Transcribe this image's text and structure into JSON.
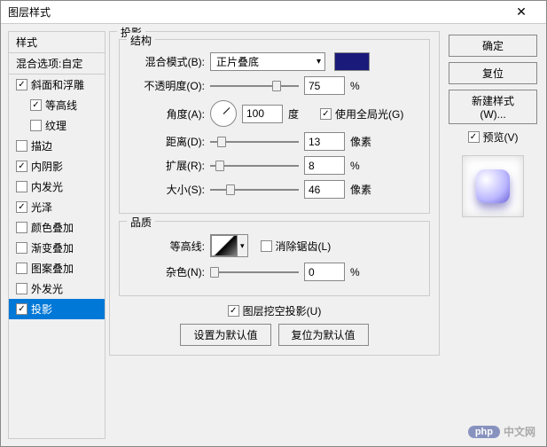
{
  "window": {
    "title": "图层样式",
    "close": "✕"
  },
  "left": {
    "header": "样式",
    "blend_options": "混合选项:自定",
    "items": [
      {
        "label": "斜面和浮雕",
        "checked": true,
        "indent": false
      },
      {
        "label": "等高线",
        "checked": true,
        "indent": true
      },
      {
        "label": "纹理",
        "checked": false,
        "indent": true
      },
      {
        "label": "描边",
        "checked": false,
        "indent": false
      },
      {
        "label": "内阴影",
        "checked": true,
        "indent": false
      },
      {
        "label": "内发光",
        "checked": false,
        "indent": false
      },
      {
        "label": "光泽",
        "checked": true,
        "indent": false
      },
      {
        "label": "颜色叠加",
        "checked": false,
        "indent": false
      },
      {
        "label": "渐变叠加",
        "checked": false,
        "indent": false
      },
      {
        "label": "图案叠加",
        "checked": false,
        "indent": false
      },
      {
        "label": "外发光",
        "checked": false,
        "indent": false
      },
      {
        "label": "投影",
        "checked": true,
        "indent": false,
        "selected": true
      }
    ]
  },
  "center": {
    "panel_title": "投影",
    "structure": {
      "legend": "结构",
      "blend_mode_label": "混合模式(B):",
      "blend_mode_value": "正片叠底",
      "color": "#1a1a7a",
      "opacity_label": "不透明度(O):",
      "opacity_value": "75",
      "opacity_unit": "%",
      "angle_label": "角度(A):",
      "angle_value": "100",
      "angle_unit": "度",
      "global_light_label": "使用全局光(G)",
      "global_light_checked": true,
      "distance_label": "距离(D):",
      "distance_value": "13",
      "distance_unit": "像素",
      "spread_label": "扩展(R):",
      "spread_value": "8",
      "spread_unit": "%",
      "size_label": "大小(S):",
      "size_value": "46",
      "size_unit": "像素"
    },
    "quality": {
      "legend": "品质",
      "contour_label": "等高线:",
      "antialias_label": "消除锯齿(L)",
      "antialias_checked": false,
      "noise_label": "杂色(N):",
      "noise_value": "0",
      "noise_unit": "%"
    },
    "knockout_label": "图层挖空投影(U)",
    "knockout_checked": true,
    "set_default": "设置为默认值",
    "reset_default": "复位为默认值"
  },
  "right": {
    "ok": "确定",
    "reset": "复位",
    "new_style": "新建样式(W)...",
    "preview_label": "预览(V)",
    "preview_checked": true
  },
  "watermark": {
    "badge": "php",
    "text": "中文网"
  }
}
